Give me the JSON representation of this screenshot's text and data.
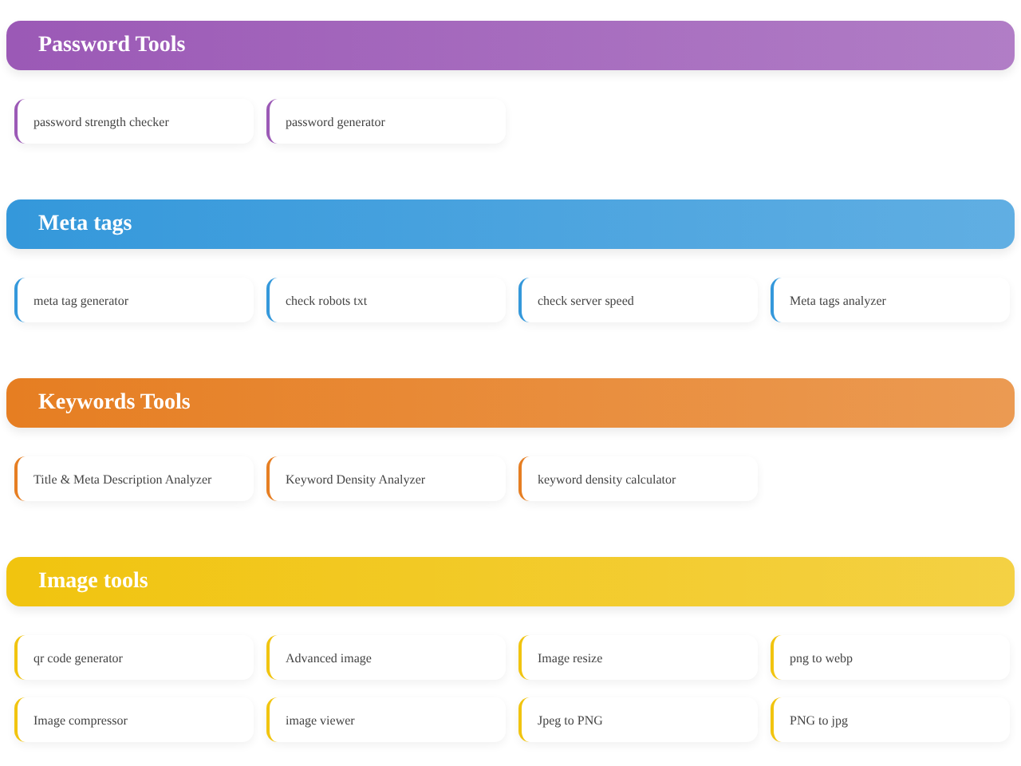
{
  "sections": [
    {
      "title": "Password Tools",
      "color": "#9b59b6",
      "tools": [
        "password strength checker",
        "password generator"
      ]
    },
    {
      "title": "Meta tags",
      "color": "#3498db",
      "tools": [
        "meta tag generator",
        "check robots txt",
        "check server speed",
        "Meta tags analyzer"
      ]
    },
    {
      "title": "Keywords Tools",
      "color": "#e67e22",
      "tools": [
        "Title & Meta Description Analyzer",
        "Keyword Density Analyzer",
        "keyword density calculator"
      ]
    },
    {
      "title": "Image tools",
      "color": "#f1c40f",
      "tools": [
        "qr code generator",
        "Advanced image",
        "Image resize",
        "png to webp",
        "Image compressor",
        "image viewer",
        "Jpeg to PNG",
        "PNG to jpg"
      ]
    }
  ]
}
